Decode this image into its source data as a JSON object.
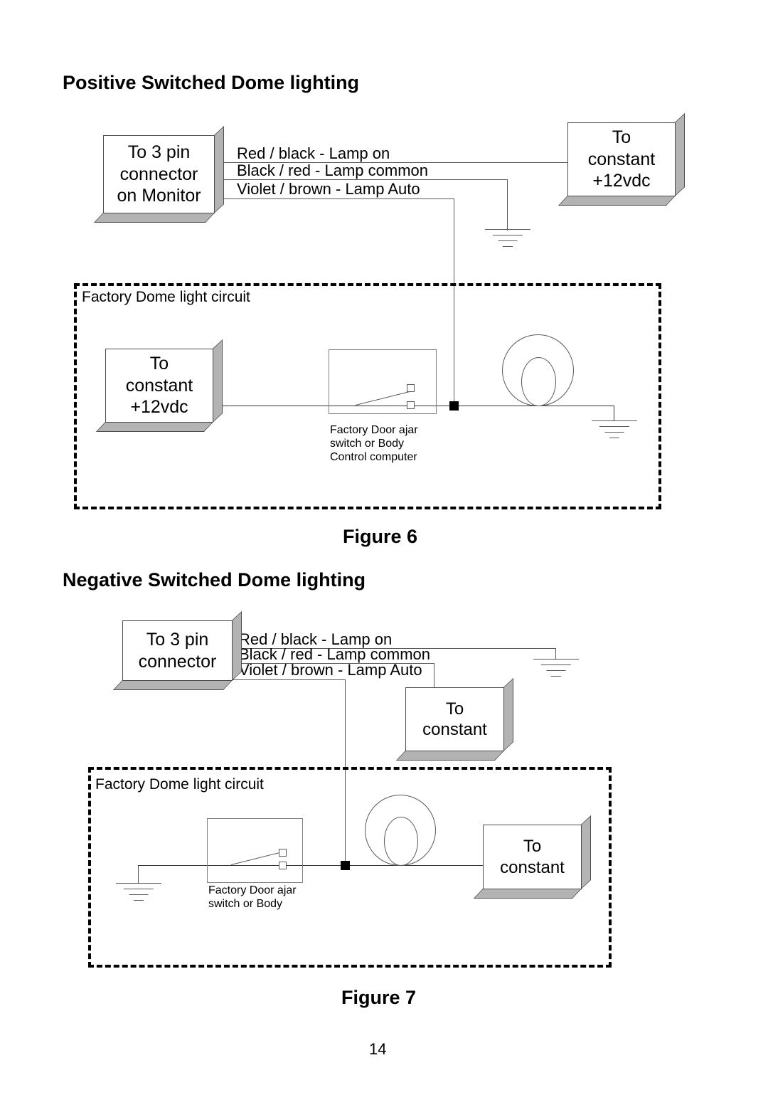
{
  "page": {
    "number": "14"
  },
  "figure6": {
    "heading": "Positive Switched Dome lighting",
    "caption": "Figure 6",
    "connector_box": {
      "line1": "To  3 pin",
      "line2": "connector",
      "line3": "on Monitor"
    },
    "power_box": {
      "line1": "To",
      "line2": "constant",
      "line3": "+12vdc"
    },
    "internal_power_box": {
      "line1": "To",
      "line2": "constant",
      "line3": "+12vdc"
    },
    "wire_labels": [
      "Red / black - Lamp on",
      "Black / red - Lamp common",
      "Violet / brown  -  Lamp Auto"
    ],
    "enclosure_label": "Factory Dome light circuit",
    "switch_caption": {
      "line1": "Factory Door ajar",
      "line2": "switch or Body",
      "line3": "Control computer"
    }
  },
  "figure7": {
    "heading": "Negative Switched Dome lighting",
    "caption": "Figure 7",
    "connector_box": {
      "line1": "To  3 pin",
      "line2": "connector"
    },
    "power_box_upper": {
      "line1": "To",
      "line2": "constant"
    },
    "power_box_lower": {
      "line1": "To",
      "line2": "constant"
    },
    "wire_labels": [
      "Red / black - Lamp on",
      "Black / red - Lamp common",
      "Violet / brown  -  Lamp Auto"
    ],
    "enclosure_label": "Factory Dome light circuit",
    "switch_caption": {
      "line1": "Factory Door ajar",
      "line2": "switch or Body"
    }
  },
  "colors": {
    "wire": "#595959",
    "box_face": "#ffffff",
    "box_shadow": "#b3b3b3",
    "ink": "#000000"
  }
}
